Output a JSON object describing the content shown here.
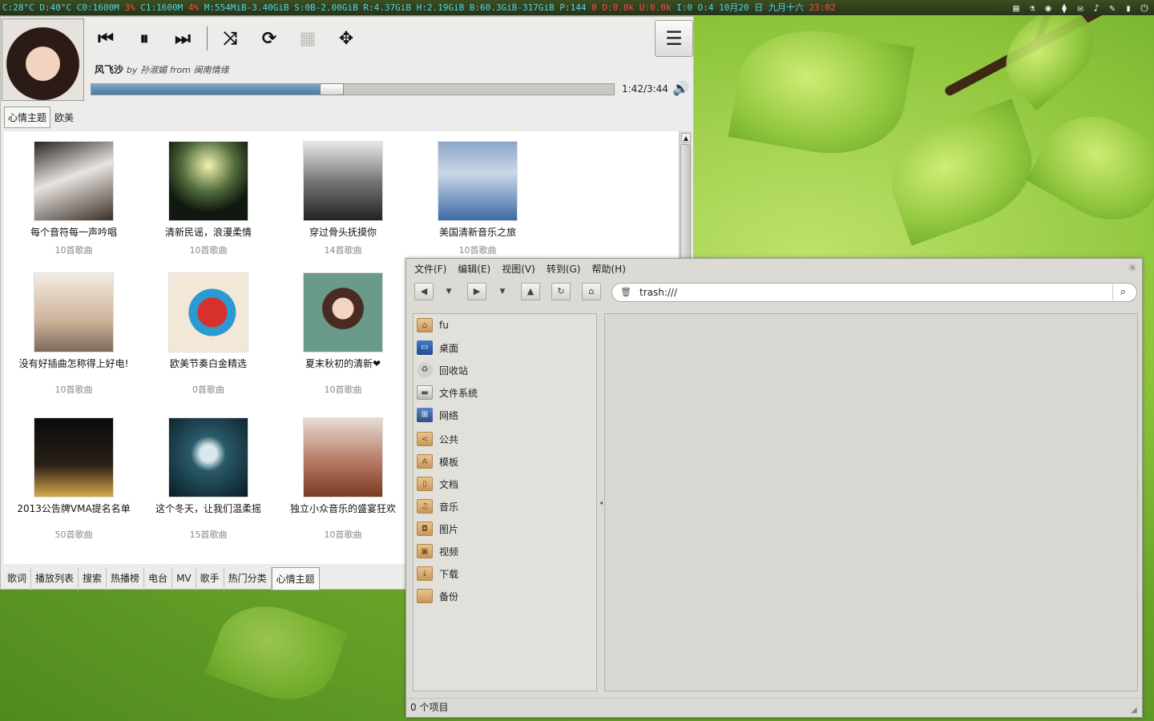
{
  "topbar": {
    "segments": [
      {
        "text": "C:28°C D:40°C C0:1600M ",
        "color": "cyan"
      },
      {
        "text": "3% ",
        "color": "red"
      },
      {
        "text": "C1:1600M ",
        "color": "cyan"
      },
      {
        "text": "4% ",
        "color": "red"
      },
      {
        "text": "M:554MiB-3.40GiB S:0B-2.00GiB R:4.37GiB H:2.19GiB B:60.3GiB-317GiB P:144 ",
        "color": "cyan"
      },
      {
        "text": "0 ",
        "color": "red"
      },
      {
        "text": "D:0.0k ",
        "color": "red"
      },
      {
        "text": "U:0.0k ",
        "color": "red"
      },
      {
        "text": "I:0 O:4   ",
        "color": "cyan"
      },
      {
        "text": "10月20 日 九月十六 ",
        "color": "cyan"
      },
      {
        "text": "23:02",
        "color": "red"
      }
    ],
    "tray_icons": [
      "note-icon",
      "flask-icon",
      "browser-icon",
      "gift-icon",
      "chat-icon",
      "volume-icon",
      "tools-icon",
      "battery-icon",
      "power-icon"
    ]
  },
  "player": {
    "song": "风飞沙",
    "by_word": "by",
    "artist": "孙淑媚",
    "from_word": "from",
    "album": "闽南情缘",
    "elapsed_time": "1:42/3:44",
    "progress_fraction": 0.44,
    "category_tabs": [
      "心情主题",
      "欧美"
    ],
    "albums": [
      {
        "name": "每个音符每一声吟唱",
        "count": "10首歌曲"
      },
      {
        "name": "清新民谣，浪漫柔情",
        "count": "10首歌曲"
      },
      {
        "name": "穿过骨头抚摸你",
        "count": "14首歌曲"
      },
      {
        "name": "美国清新音乐之旅",
        "count": "10首歌曲"
      },
      {
        "name": "没有好插曲怎称得上好电!",
        "count": "10首歌曲"
      },
      {
        "name": "欧美节奏白金精选",
        "count": "0首歌曲"
      },
      {
        "name": "夏末秋初的清新❤",
        "count": "10首歌曲"
      },
      {
        "name": "2013公告牌VMA提名名单",
        "count": "50首歌曲"
      },
      {
        "name": "这个冬天，让我们温柔摇",
        "count": "15首歌曲"
      },
      {
        "name": "独立小众音乐的盛宴狂欢",
        "count": "10首歌曲"
      }
    ],
    "bottom_tabs": [
      "歌词",
      "播放列表",
      "搜索",
      "热播榜",
      "电台",
      "MV",
      "歌手",
      "热门分类",
      "心情主题"
    ]
  },
  "filemanager": {
    "menus": [
      "文件(F)",
      "编辑(E)",
      "视图(V)",
      "转到(G)",
      "帮助(H)"
    ],
    "address": "trash:///",
    "places": [
      {
        "label": "fu",
        "icon": "home-icon"
      },
      {
        "label": "桌面",
        "icon": "desktop-icon"
      },
      {
        "label": "回收站",
        "icon": "trash-icon"
      },
      {
        "label": "文件系统",
        "icon": "drive-icon"
      },
      {
        "label": "网络",
        "icon": "network-icon"
      },
      {
        "label": "公共",
        "icon": "share-folder-icon"
      },
      {
        "label": "模板",
        "icon": "template-folder-icon"
      },
      {
        "label": "文档",
        "icon": "documents-folder-icon"
      },
      {
        "label": "音乐",
        "icon": "music-folder-icon"
      },
      {
        "label": "图片",
        "icon": "pictures-folder-icon"
      },
      {
        "label": "视频",
        "icon": "videos-folder-icon"
      },
      {
        "label": "下载",
        "icon": "downloads-folder-icon"
      },
      {
        "label": "备份",
        "icon": "backup-folder-icon"
      }
    ],
    "status": "0 个项目"
  }
}
